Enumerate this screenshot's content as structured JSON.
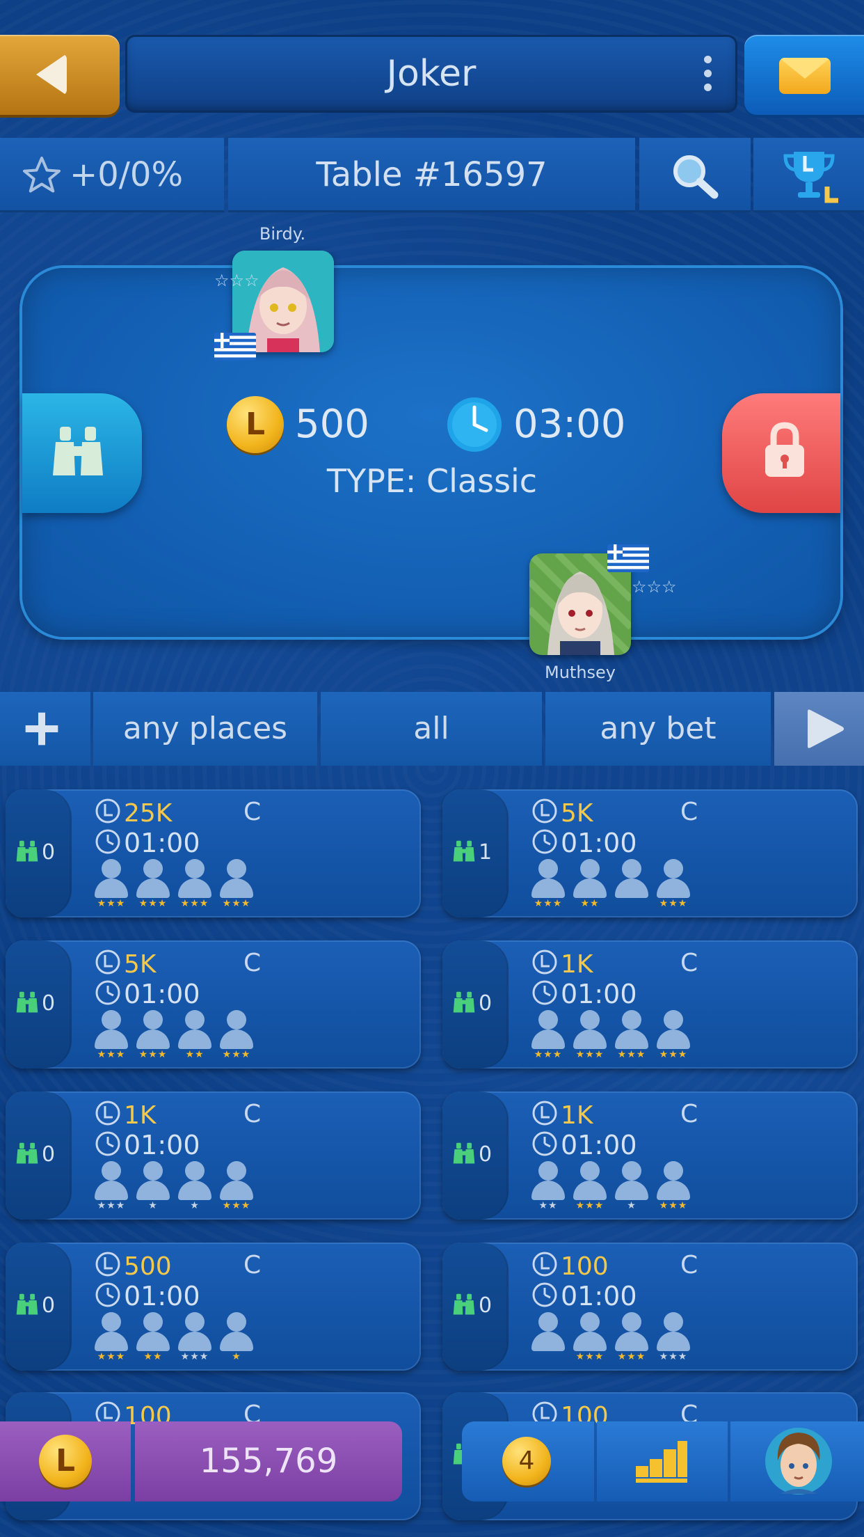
{
  "header": {
    "title": "Joker"
  },
  "info_bar": {
    "rating": "+0/0%",
    "table_label": "Table #16597"
  },
  "table": {
    "player_top": {
      "name": "Birdy.",
      "stars": "☆☆☆"
    },
    "player_bottom": {
      "name": "Muthsey",
      "stars": "☆☆☆"
    },
    "bet": "500",
    "time": "03:00",
    "type_line": "TYPE: Classic"
  },
  "filters": {
    "places": "any places",
    "all": "all",
    "bet": "any bet"
  },
  "games": [
    {
      "watchers": "0",
      "bet": "25K",
      "type": "C",
      "time": "01:00",
      "players": [
        {
          "s": "★★★",
          "c": "#f2b928"
        },
        {
          "s": "★★★",
          "c": "#f2b928"
        },
        {
          "s": "★★★",
          "c": "#f2b928"
        },
        {
          "s": "★★★",
          "c": "#f2b928"
        }
      ]
    },
    {
      "watchers": "1",
      "bet": "5K",
      "type": "C",
      "time": "01:00",
      "players": [
        {
          "s": "★★★",
          "c": "#f2b928"
        },
        {
          "s": "★★",
          "c": "#f2b928"
        },
        {
          "s": "",
          "c": "#f2b928"
        },
        {
          "s": "★★★",
          "c": "#f2b928"
        }
      ]
    },
    {
      "watchers": "0",
      "bet": "5K",
      "type": "C",
      "time": "01:00",
      "players": [
        {
          "s": "★★★",
          "c": "#f2b928"
        },
        {
          "s": "★★★",
          "c": "#f2b928"
        },
        {
          "s": "★★",
          "c": "#f2b928"
        },
        {
          "s": "★★★",
          "c": "#f2b928"
        }
      ]
    },
    {
      "watchers": "0",
      "bet": "1K",
      "type": "C",
      "time": "01:00",
      "players": [
        {
          "s": "★★★",
          "c": "#f2b928"
        },
        {
          "s": "★★★",
          "c": "#f2b928"
        },
        {
          "s": "★★★",
          "c": "#f2b928"
        },
        {
          "s": "★★★",
          "c": "#f2b928"
        }
      ]
    },
    {
      "watchers": "0",
      "bet": "1K",
      "type": "C",
      "time": "01:00",
      "players": [
        {
          "s": "★★★",
          "c": "#c7d3e2"
        },
        {
          "s": "★",
          "c": "#c7d3e2"
        },
        {
          "s": "★",
          "c": "#c7d3e2"
        },
        {
          "s": "★★★",
          "c": "#f2b928"
        }
      ]
    },
    {
      "watchers": "0",
      "bet": "1K",
      "type": "C",
      "time": "01:00",
      "players": [
        {
          "s": "★★",
          "c": "#c7d3e2"
        },
        {
          "s": "★★★",
          "c": "#f2b928"
        },
        {
          "s": "★",
          "c": "#c7d3e2"
        },
        {
          "s": "★★★",
          "c": "#f2b928"
        }
      ]
    },
    {
      "watchers": "0",
      "bet": "500",
      "type": "C",
      "time": "01:00",
      "players": [
        {
          "s": "★★★",
          "c": "#f2b928"
        },
        {
          "s": "★★",
          "c": "#f2b928"
        },
        {
          "s": "★★★",
          "c": "#c7d3e2"
        },
        {
          "s": "★",
          "c": "#f2b928"
        }
      ]
    },
    {
      "watchers": "0",
      "bet": "100",
      "type": "C",
      "time": "01:00",
      "players": [
        {
          "s": "",
          "c": "#f2b928"
        },
        {
          "s": "★★★",
          "c": "#f2b928"
        },
        {
          "s": "★★★",
          "c": "#f2b928"
        },
        {
          "s": "★★★",
          "c": "#c7d3e2"
        }
      ]
    },
    {
      "watchers": "",
      "bet": "100",
      "type": "C",
      "time": "",
      "players": []
    },
    {
      "watchers": "",
      "bet": "100",
      "type": "C",
      "time": "",
      "players": []
    }
  ],
  "bottom_bar": {
    "coin_letter": "L",
    "balance": "155,769",
    "notifications": "4"
  },
  "colors": {
    "accent_gold": "#f4c84a",
    "back_button": "#d3921f",
    "lock_button": "#f05a5a",
    "watch_button": "#1e9ad6",
    "purple_bar": "#8a4bb0"
  },
  "icons": [
    "back-arrow-icon",
    "menu-dots-icon",
    "mail-icon",
    "star-outline-icon",
    "search-icon",
    "trophy-icon",
    "gold-coin-icon",
    "clock-icon",
    "binoculars-icon",
    "lock-icon",
    "plus-icon",
    "play-icon",
    "person-icon",
    "leaderboard-icon",
    "avatar-icon",
    "greek-flag-icon"
  ]
}
